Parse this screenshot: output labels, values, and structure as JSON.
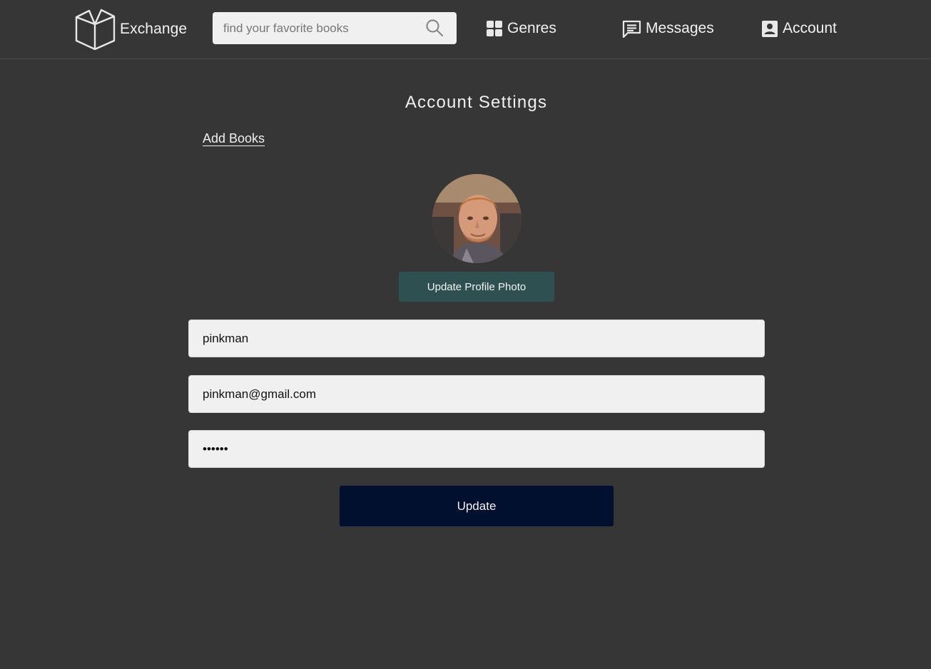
{
  "nav": {
    "brand": "Exchange",
    "brand_icon": "open-book-icon",
    "search": {
      "placeholder": "find your favorite books",
      "value": "",
      "icon": "search-icon"
    },
    "items": [
      {
        "label": "Genres",
        "icon": "grid-icon"
      },
      {
        "label": "Messages",
        "icon": "message-icon"
      },
      {
        "label": "Account",
        "icon": "account-icon"
      }
    ]
  },
  "main": {
    "title": "Account Settings",
    "add_books_link": "Add Books",
    "profile_photo_button": "Update Profile Photo",
    "form": {
      "username": "pinkman",
      "email": "pinkman@gmail.com",
      "password": "••••••"
    },
    "update_button": "Update"
  },
  "colors": {
    "background": "#363636",
    "input_background": "#f0f0f0",
    "photo_button": "#2f5050",
    "update_button": "#01102e",
    "text": "#f0f0f0"
  }
}
